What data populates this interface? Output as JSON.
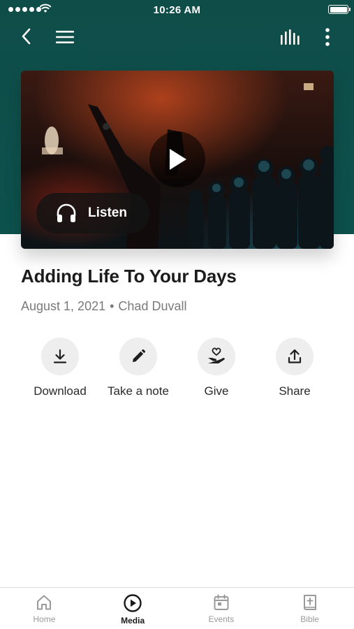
{
  "status_bar": {
    "time": "10:26 AM"
  },
  "hero": {
    "listen_label": "Listen"
  },
  "sermon": {
    "title": "Adding Life To Your Days",
    "date": "August 1, 2021",
    "separator": "•",
    "speaker": "Chad Duvall"
  },
  "actions": [
    {
      "label": "Download",
      "icon": "download-icon"
    },
    {
      "label": "Take a note",
      "icon": "pencil-icon"
    },
    {
      "label": "Give",
      "icon": "give-hand-heart-icon"
    },
    {
      "label": "Share",
      "icon": "share-upload-icon"
    }
  ],
  "tabs": [
    {
      "label": "Home",
      "icon": "home-icon",
      "active": false
    },
    {
      "label": "Media",
      "icon": "play-circle-icon",
      "active": true
    },
    {
      "label": "Events",
      "icon": "calendar-icon",
      "active": false
    },
    {
      "label": "Bible",
      "icon": "bible-icon",
      "active": false
    }
  ],
  "colors": {
    "header": "#0f4d49",
    "action_circle": "#eeeeee",
    "meta_text": "#7a7a7a",
    "tab_inactive": "#9a9a9a"
  }
}
